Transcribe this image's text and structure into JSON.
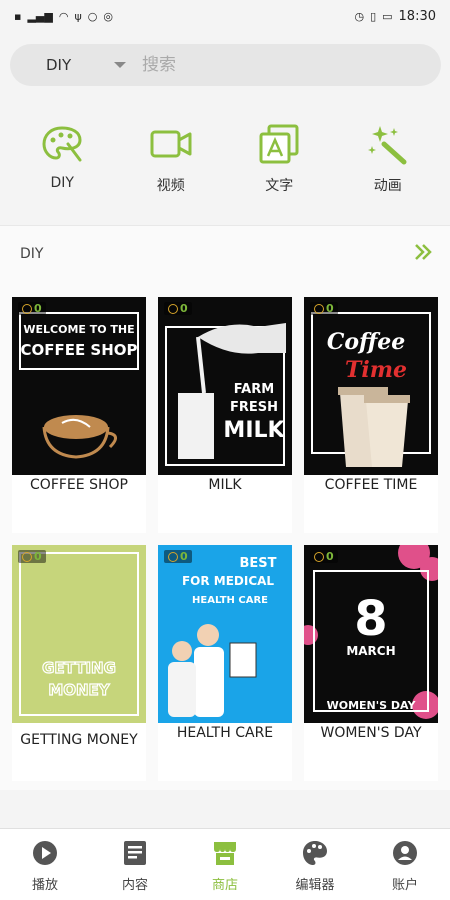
{
  "status_bar": {
    "time": "18:30"
  },
  "search": {
    "filter": "DIY",
    "placeholder": "搜索"
  },
  "categories": [
    {
      "label": "DIY",
      "icon": "palette-icon"
    },
    {
      "label": "视频",
      "icon": "video-icon"
    },
    {
      "label": "文字",
      "icon": "text-icon"
    },
    {
      "label": "动画",
      "icon": "sparkle-wand-icon"
    }
  ],
  "section": {
    "title": "DIY",
    "cards": [
      {
        "title": "COFFEE SHOP",
        "coins": "0",
        "art": [
          "WELCOME TO THE",
          "COFFEE SHOP"
        ]
      },
      {
        "title": "MILK",
        "coins": "0",
        "art": [
          "FARM",
          "FRESH",
          "MILK"
        ]
      },
      {
        "title": "COFFEE TIME",
        "coins": "0",
        "art": [
          "Coffee",
          "Time"
        ]
      },
      {
        "title": "GETTING MONEY",
        "coins": "0",
        "art": [
          "GETTING",
          "MONEY"
        ]
      },
      {
        "title": "HEALTH CARE",
        "coins": "0",
        "art": [
          "BEST",
          "FOR MEDICAL",
          "HEALTH CARE"
        ]
      },
      {
        "title": "WOMEN'S DAY",
        "coins": "0",
        "art": [
          "8",
          "MARCH",
          "WOMEN'S DAY"
        ]
      }
    ]
  },
  "tabs": [
    {
      "label": "播放",
      "icon": "play-icon",
      "active": false
    },
    {
      "label": "内容",
      "icon": "document-icon",
      "active": false
    },
    {
      "label": "商店",
      "icon": "store-icon",
      "active": true
    },
    {
      "label": "编辑器",
      "icon": "palette-icon",
      "active": false
    },
    {
      "label": "账户",
      "icon": "user-icon",
      "active": false
    }
  ],
  "colors": {
    "accent": "#8cbf3f",
    "coin": "#d6a42a"
  }
}
